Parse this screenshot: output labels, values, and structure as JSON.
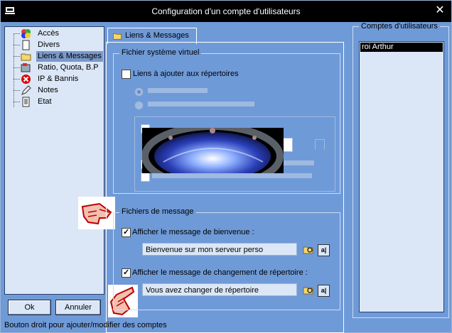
{
  "window": {
    "title": "Configuration d'un compte d'utilisateurs"
  },
  "tree": {
    "items": [
      {
        "label": "Accès",
        "icon": "access-icon"
      },
      {
        "label": "Divers",
        "icon": "page-icon"
      },
      {
        "label": "Liens & Messages",
        "icon": "folder-icon",
        "selected": true
      },
      {
        "label": "Ratio, Quota, B.P",
        "icon": "ratio-icon"
      },
      {
        "label": "IP & Bannis",
        "icon": "ban-icon"
      },
      {
        "label": "Notes",
        "icon": "pencil-icon"
      },
      {
        "label": "Etat",
        "icon": "document-icon"
      }
    ]
  },
  "buttons": {
    "ok": "Ok",
    "cancel": "Annuler"
  },
  "tab": {
    "label": "Liens & Messages"
  },
  "virtual_fs": {
    "group_title": "Fichier système virtuel",
    "links_checkbox": "Liens à ajouter aux répertoires",
    "links_checked": false
  },
  "messages": {
    "group_title": "Fichiers de message",
    "welcome_checkbox": "Afficher le message de bienvenue :",
    "welcome_checked": true,
    "welcome_value": "Bienvenue sur mon serveur perso",
    "changedir_checkbox": "Afficher le message de changement de répertoire :",
    "changedir_checked": true,
    "changedir_value": "Vous avez changer de répertoire",
    "browse_label": "a|"
  },
  "accounts": {
    "group_title": "Comptes d'utilisateurs",
    "items": [
      "roi Arthur"
    ]
  },
  "status": "Bouton droit pour ajouter/modifier des comptes",
  "colors": {
    "background": "#6f9ad8",
    "selected": "#7a98c8",
    "list": "#dbe7f7"
  }
}
